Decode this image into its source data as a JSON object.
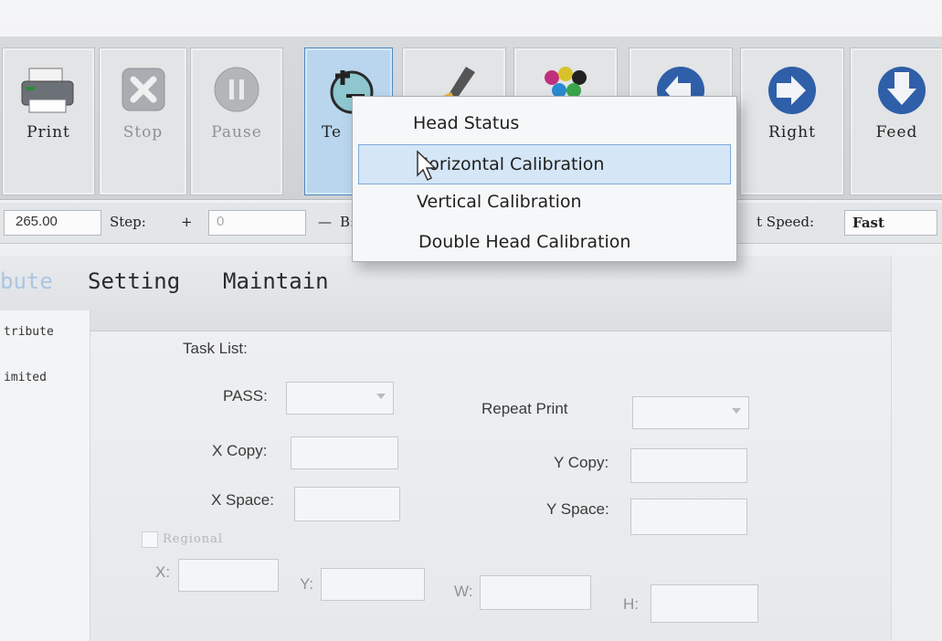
{
  "toolbar": {
    "buttons": [
      {
        "label": "Print",
        "icon": "printer-icon",
        "state": "enabled"
      },
      {
        "label": "Stop",
        "icon": "stop-x-icon",
        "state": "disabled"
      },
      {
        "label": "Pause",
        "icon": "pause-icon",
        "state": "disabled"
      },
      {
        "label": "Te",
        "icon": "test-icon",
        "state": "active"
      },
      {
        "label": "",
        "icon": "clean-brush-icon",
        "state": "enabled"
      },
      {
        "label": "",
        "icon": "ink-drops-icon",
        "state": "enabled"
      },
      {
        "label": "",
        "icon": "left-arrow-icon",
        "state": "enabled"
      },
      {
        "label": "Right",
        "icon": "right-arrow-icon",
        "state": "enabled"
      },
      {
        "label": "Feed",
        "icon": "feed-down-arrow-icon",
        "state": "enabled"
      }
    ]
  },
  "steprow": {
    "position_value": "265.00",
    "step_label": "Step:",
    "plus": "+",
    "step_value": "0",
    "minus": "—",
    "b_label": "B:",
    "speed_label": "t Speed:",
    "speed_value": "Fast"
  },
  "tabs": [
    {
      "label": "bute",
      "state": "inactive"
    },
    {
      "label": "Setting",
      "state": "normal"
    },
    {
      "label": "Maintain",
      "state": "normal"
    }
  ],
  "left_list": [
    "tribute",
    "imited"
  ],
  "form": {
    "task_list": "Task List:",
    "pass": "PASS:",
    "repeat_print": "Repeat Print",
    "x_copy": "X Copy:",
    "y_copy": "Y Copy:",
    "x_space": "X Space:",
    "y_space": "Y Space:",
    "regional": "Regional",
    "x": "X:",
    "y": "Y:",
    "w": "W:",
    "h": "H:"
  },
  "menu": {
    "items": [
      {
        "label": "Head Status",
        "highlighted": false
      },
      {
        "label": "Horizontal Calibration",
        "highlighted": true
      },
      {
        "label": "Vertical Calibration",
        "highlighted": false
      },
      {
        "label": "Double Head Calibration",
        "highlighted": false
      }
    ]
  },
  "colors": {
    "highlight": "#d5e6f6",
    "highlight_border": "#7fa8d8",
    "arrow_blue": "#2f5fa8",
    "disabled_text": "#8e9194"
  }
}
